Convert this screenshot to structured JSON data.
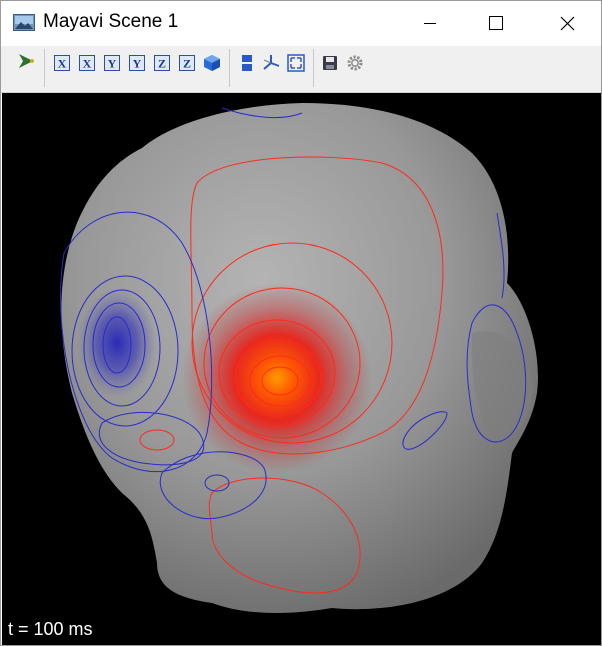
{
  "window": {
    "title": "Mayavi Scene 1",
    "controls": [
      "minimize-icon",
      "maximize-icon",
      "close-icon"
    ]
  },
  "toolbar": {
    "groups": [
      [
        "pipeline-icon"
      ],
      [
        "view-x-minus-icon",
        "view-x-plus-icon",
        "view-y-minus-icon",
        "view-y-plus-icon",
        "view-z-minus-icon",
        "view-z-plus-icon",
        "isometric-view-icon"
      ],
      [
        "parallel-projection-icon",
        "toggle-axes-indicator-icon",
        "full-screen-icon"
      ],
      [
        "save-icon",
        "configure-scene-icon"
      ]
    ],
    "axis_letters": [
      "X",
      "X",
      "Y",
      "Y",
      "Z",
      "Z"
    ]
  },
  "scene": {
    "time_label": "t = 100 ms",
    "colors": {
      "background": "#000000",
      "surface": "#9a9a9a",
      "positive": "#ff2a1a",
      "negative": "#2a2acc",
      "peak": "#ffa500"
    }
  }
}
